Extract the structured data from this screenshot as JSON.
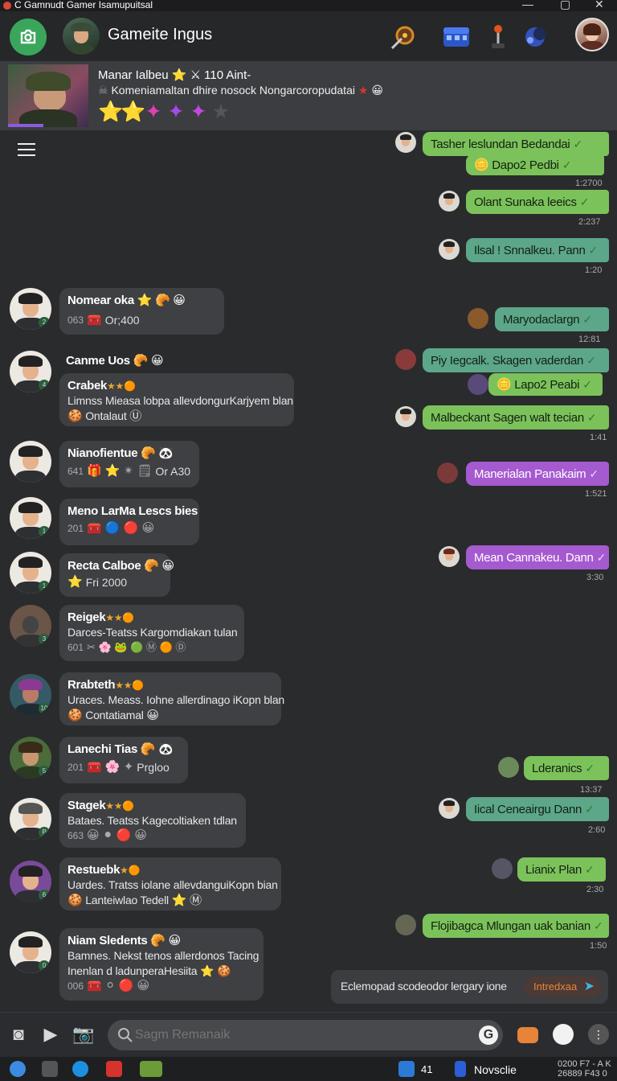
{
  "window": {
    "title": "C Gamnudt Gamer Isamupuitsal"
  },
  "header": {
    "title": "Gameite Ingus",
    "icons": [
      "home-icon",
      "quest-icon",
      "treasure-chest-icon",
      "joystick-icon",
      "controller-icon"
    ]
  },
  "featured": {
    "title": "Manar Ialbeu ⭐ ⚔ 110 Aint-",
    "description": "Komeniamaltan dhire nosock Nongarcoropudatai",
    "stars": [
      "⭐",
      "⭐",
      "✦",
      "✦",
      "✦",
      "★"
    ]
  },
  "incoming": [
    {
      "name": "Nomear oka",
      "emojis": "⭐ 🥐 😀",
      "meta_prefix": "063",
      "meta_icons": "🧰",
      "meta_text": "Or;400"
    },
    {
      "name": "Canme Uos",
      "emojis": "🥐 😀"
    },
    {
      "name": "Crabek",
      "emojis": "★★🟠",
      "text": "Limnss Mieasa lobpa allevdongurKarjyem blan",
      "line2": "Ontalaut",
      "line2_icon": "🍪",
      "line2_icon2": "Ⓤ"
    },
    {
      "name": "Nianofientue",
      "emojis": "🥐 🐼",
      "meta_prefix": "641",
      "meta_icons": "🎁 ⭐ ✴ 🗒",
      "meta_text": "Or A30"
    },
    {
      "name": "Meno LarMa Lescs bies",
      "meta_prefix": "201",
      "meta_icons": "🧰 🔵 🔴 😀"
    },
    {
      "name": "Recta Calboe",
      "emojis": "🥐 😀",
      "meta_prefix": "",
      "meta_icons": "⭐",
      "meta_text": "Fri 2000"
    },
    {
      "name": "Reigek",
      "emojis": "★★🟠",
      "text": "Darces-Teatss Kargomdiakan tulan",
      "meta_prefix": "601",
      "meta_icons": "✂ 🌸 🐸 🟢 Ⓜ 🟠 Ⓓ"
    },
    {
      "name": "Rrabteth",
      "emojis": "★★🟠",
      "text": "Uraces. Meass. Iohne allerdinago iKopn blan",
      "line2": "Contatiamal",
      "line2_icon": "🍪",
      "line2_icon2": "😀"
    },
    {
      "name": "Lanechi Tias",
      "emojis": "🥐 🐼",
      "meta_prefix": "201",
      "meta_icons": "🧰 🌸 ✦",
      "meta_text": "Prgloo"
    },
    {
      "name": "Stagek",
      "emojis": "★★🟠",
      "text": "Bataes. Teatss Kagecoltiaken tdlan",
      "meta_prefix": "663",
      "meta_icons": "😀 ⚫ 🔴 😀"
    },
    {
      "name": "Restuebk",
      "emojis": "★🟠",
      "text": "Uardes. Tratss iolane allevdanguiKopn bian",
      "line2": "Lanteiwlao Tedell",
      "line2_icon": "🍪",
      "line2_icon2": "⭐ Ⓜ"
    },
    {
      "name": "Niam Sledents",
      "emojis": "🥐 😀",
      "text": "Bamnes. Nekst tenos allerdonos Tacing",
      "text2": "Inenlan d ladunperaHesiita ⭐ 🍪",
      "meta_prefix": "006",
      "meta_icons": "🧰 ⚪ 🔴 😀"
    }
  ],
  "outgoing": [
    {
      "text": "Tasher leslundan Bedandai",
      "color": "green"
    },
    {
      "text": "Dapo2 Pedbi",
      "color": "green",
      "icon": "🪙"
    },
    {
      "text": "Olant Sunaka leeics",
      "color": "green"
    },
    {
      "text": "Ilsal ! Snnalkeu. Pann",
      "color": "teal"
    },
    {
      "text": "Maryodaclargn",
      "color": "teal"
    },
    {
      "text": "Piy Iegcalk. Skagen vaderdan",
      "color": "teal"
    },
    {
      "text": "Lapo2 Peabi",
      "color": "green",
      "icon": "🪙"
    },
    {
      "text": "Malbeckant Sagen walt tecian",
      "color": "green"
    },
    {
      "text": "Manerialan Panakaim",
      "color": "purple"
    },
    {
      "text": "Mean Cannakeu. Dann",
      "color": "purple"
    },
    {
      "text": "Lderanics",
      "color": "green"
    },
    {
      "text": "Iical Ceneairgu Dann",
      "color": "teal"
    },
    {
      "text": "Lianix Plan",
      "color": "green"
    },
    {
      "text": "Flojibagca Mlungan uak banian",
      "color": "green"
    }
  ],
  "timestamps": [
    "1:2700",
    "2:237",
    "1:20",
    "12:81",
    "1:41",
    "1:521",
    "3:30",
    "13:37",
    "2:60",
    "2:30",
    "1:50"
  ],
  "suggestion": {
    "text": "Eclemopad scodeodor lergary ione",
    "action_label": "Intredxaa"
  },
  "input": {
    "placeholder": "Sagm Remanaik"
  },
  "taskbar": {
    "status_text": "Novsclie",
    "count": "41",
    "clock_line1": "0200 F7 - A K",
    "clock_line2": "26889 F43 0"
  }
}
